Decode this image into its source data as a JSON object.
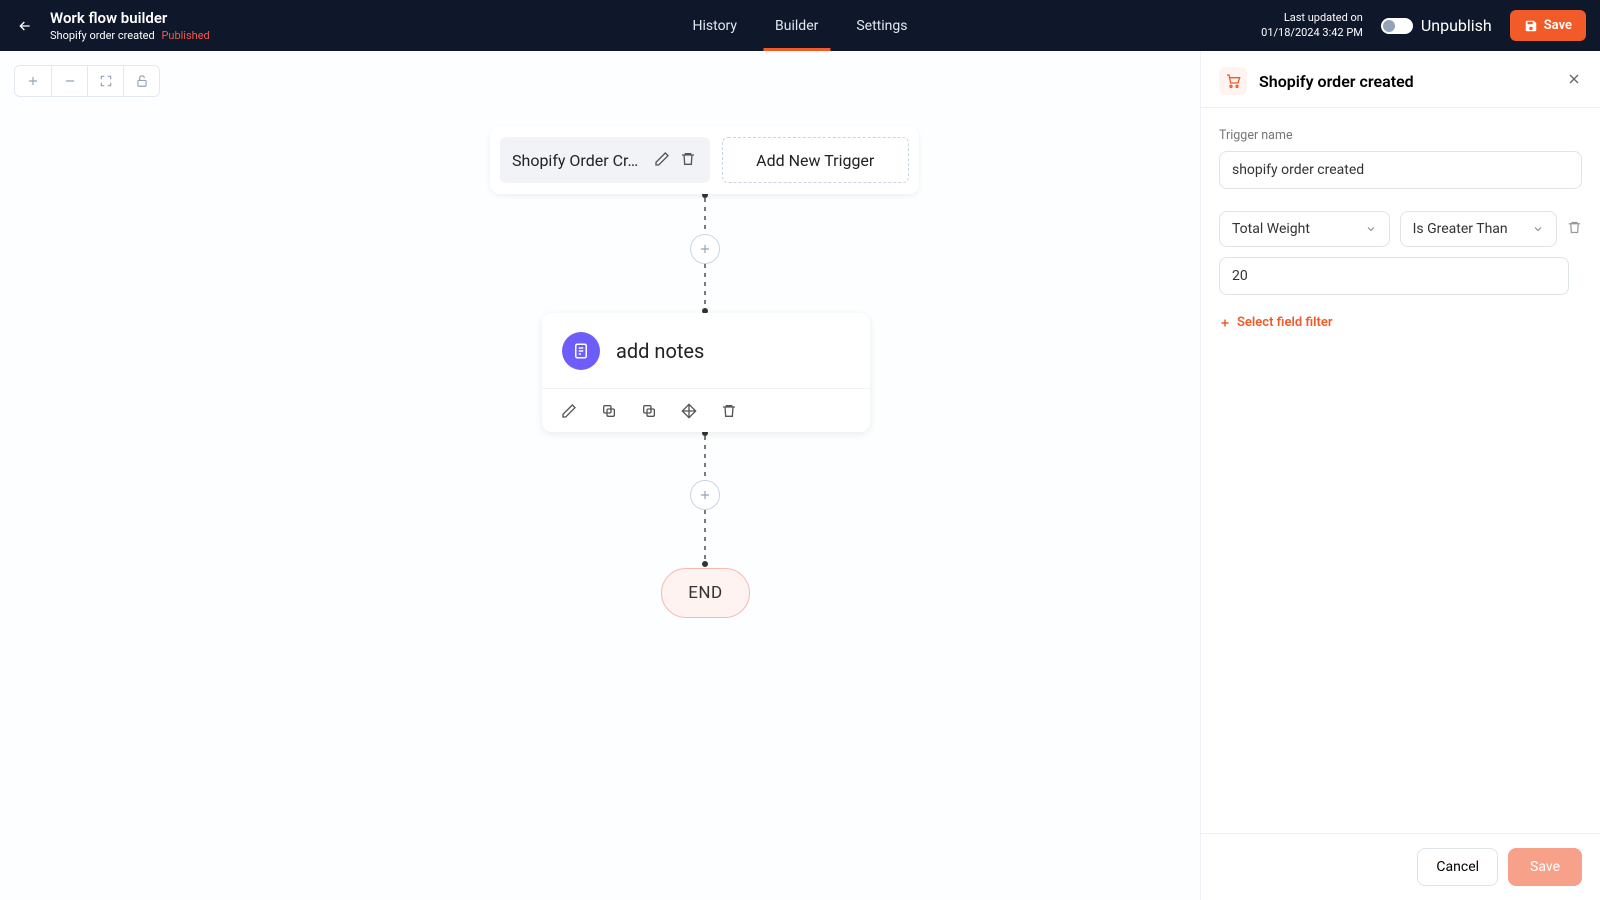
{
  "header": {
    "title": "Work flow builder",
    "subtitle": "Shopify order created",
    "status": "Published",
    "tabs": [
      "History",
      "Builder",
      "Settings"
    ],
    "active_tab": "Builder",
    "last_updated_label": "Last updated on",
    "last_updated_value": "01/18/2024 3:42 PM",
    "toggle_label": "Unpublish",
    "save": "Save"
  },
  "canvas": {
    "trigger_chip": "Shopify Order Cr…",
    "add_trigger": "Add New Trigger",
    "action_title": "add notes",
    "end": "END"
  },
  "panel": {
    "title": "Shopify order created",
    "trigger_name_label": "Trigger name",
    "trigger_name_value": "shopify order created",
    "filter_field": "Total Weight",
    "filter_op": "Is Greater Than",
    "filter_value": "20",
    "add_filter": "Select field filter",
    "cancel": "Cancel",
    "save": "Save"
  }
}
